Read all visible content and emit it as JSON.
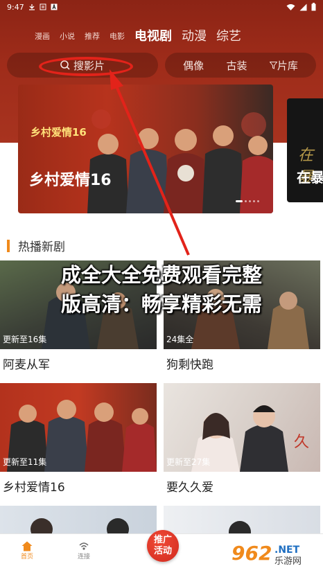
{
  "status_bar": {
    "time": "9:47",
    "left_icons": [
      "download-icon",
      "text-notification-icon",
      "a-icon"
    ],
    "right_icons": [
      "wifi-icon",
      "signal-icon",
      "battery-icon"
    ]
  },
  "nav": {
    "categories": [
      {
        "label": "漫画",
        "size": "small"
      },
      {
        "label": "小说",
        "size": "small"
      },
      {
        "label": "推荐",
        "size": "small"
      },
      {
        "label": "电影",
        "size": "small"
      },
      {
        "label": "电视剧",
        "size": "large",
        "active": true
      },
      {
        "label": "动漫",
        "size": "large"
      },
      {
        "label": "综艺",
        "size": "large"
      }
    ]
  },
  "search": {
    "placeholder": "搜影片",
    "icon": "search-icon"
  },
  "filters": {
    "items": [
      "偶像",
      "古装"
    ],
    "library_label": "片库",
    "library_icon": "filter-icon"
  },
  "banner": {
    "title": "乡村爱情16",
    "logo_text": "乡村爱情16",
    "next_title": "在暴",
    "next_deco": "在暴"
  },
  "section": {
    "title": "热播新剧"
  },
  "headline": {
    "line1": "成全大全免费观看完整",
    "line2": "版高清：畅享精彩无需"
  },
  "cards": [
    {
      "tag": "更新至16集",
      "title": "阿麦从军"
    },
    {
      "tag": "24集全",
      "title": "狗剩快跑"
    },
    {
      "tag": "更新至11集",
      "title": "乡村爱情16"
    },
    {
      "tag": "更新至27集",
      "title": "要久久爱"
    }
  ],
  "bottom_nav": {
    "home": "首页",
    "live": "连接",
    "promo_line1": "推广",
    "promo_line2": "活动"
  },
  "watermark": {
    "brand": "962",
    "suffix": ".NET",
    "sub": "乐游网"
  },
  "colors": {
    "header_red": "#9f2c1a",
    "accent_orange": "#f08a1c",
    "annotation_red": "#e2231a"
  }
}
